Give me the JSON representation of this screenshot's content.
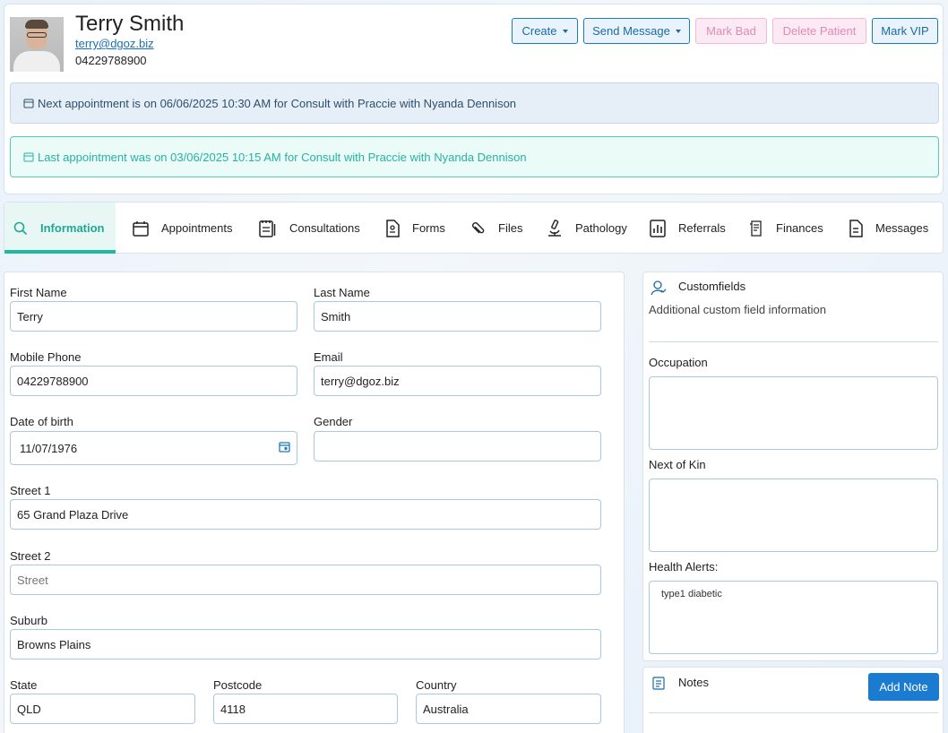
{
  "patient": {
    "name": "Terry Smith",
    "email": "terry@dgoz.biz",
    "phone": "04229788900"
  },
  "actions": {
    "create": "Create",
    "send_message": "Send Message",
    "mark_bad": "Mark Bad",
    "delete_patient": "Delete Patient",
    "mark_vip": "Mark VIP"
  },
  "alerts": {
    "next": "Next appointment is on 06/06/2025 10:30 AM for Consult with Praccie with Nyanda Dennison",
    "last": "Last appointment was on 03/06/2025 10:15 AM for Consult with Praccie with Nyanda Dennison"
  },
  "tabs": [
    {
      "label": "Information",
      "icon": "search-icon"
    },
    {
      "label": "Appointments",
      "icon": "calendar-icon"
    },
    {
      "label": "Consultations",
      "icon": "clipboard-icon"
    },
    {
      "label": "Forms",
      "icon": "form-icon"
    },
    {
      "label": "Files",
      "icon": "paperclip-icon"
    },
    {
      "label": "Pathology",
      "icon": "microscope-icon"
    },
    {
      "label": "Referrals",
      "icon": "referral-icon"
    },
    {
      "label": "Finances",
      "icon": "receipt-icon"
    },
    {
      "label": "Messages",
      "icon": "message-icon"
    }
  ],
  "form": {
    "first_name": {
      "label": "First Name",
      "value": "Terry"
    },
    "last_name": {
      "label": "Last Name",
      "value": "Smith"
    },
    "mobile": {
      "label": "Mobile Phone",
      "value": "04229788900"
    },
    "email": {
      "label": "Email",
      "value": "terry@dgoz.biz"
    },
    "dob": {
      "label": "Date of birth",
      "value": "11/07/1976"
    },
    "gender": {
      "label": "Gender",
      "value": ""
    },
    "street1": {
      "label": "Street 1",
      "value": "65 Grand Plaza Drive"
    },
    "street2": {
      "label": "Street 2",
      "placeholder": "Street"
    },
    "suburb": {
      "label": "Suburb",
      "value": "Browns Plains"
    },
    "state": {
      "label": "State",
      "value": "QLD"
    },
    "postcode": {
      "label": "Postcode",
      "value": "4118"
    },
    "country": {
      "label": "Country",
      "value": "Australia"
    }
  },
  "customfields": {
    "title": "Customfields",
    "subtitle": "Additional custom field information",
    "occupation": {
      "label": "Occupation",
      "value": ""
    },
    "next_of_kin": {
      "label": "Next of Kin",
      "value": ""
    },
    "health_alerts": {
      "label": "Health Alerts:",
      "value": "type1 diabetic"
    }
  },
  "notes": {
    "title": "Notes",
    "add_label": "Add Note"
  }
}
